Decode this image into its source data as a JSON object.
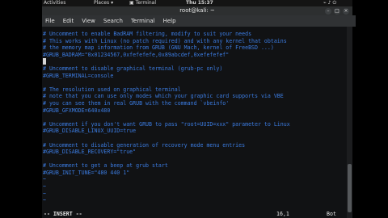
{
  "topbar": {
    "activities": "Activities",
    "places": "Places",
    "terminal_app": "Terminal",
    "clock": "Thu 15:37"
  },
  "window": {
    "title": "root@kali: ~"
  },
  "menu": [
    "File",
    "Edit",
    "View",
    "Search",
    "Terminal",
    "Help"
  ],
  "editor": {
    "lines": [
      {
        "text": "# Uncomment to enable BadRAM filtering, modify to suit your needs",
        "style": "comment"
      },
      {
        "text": "# This works with Linux (no patch required) and with any kernel that obtains",
        "style": "comment"
      },
      {
        "text": "# the memory map information from GRUB (GNU Mach, kernel of FreeBSD ...)",
        "style": "comment"
      },
      {
        "text": "#GRUB_BADRAM=\"0x01234567,0xfefefefe,0x89abcdef,0xefefefef\"",
        "style": "comment"
      },
      {
        "text": "",
        "style": "cursor"
      },
      {
        "text": "# Uncomment to disable graphical terminal (grub-pc only)",
        "style": "comment"
      },
      {
        "text": "#GRUB_TERMINAL=console",
        "style": "comment"
      },
      {
        "text": "",
        "style": "normal"
      },
      {
        "text": "# The resolution used on graphical terminal",
        "style": "comment"
      },
      {
        "text": "# note that you can use only modes which your graphic card supports via VBE",
        "style": "comment"
      },
      {
        "text": "# you can see them in real GRUB with the command `vbeinfo'",
        "style": "comment"
      },
      {
        "text": "#GRUB_GFXMODE=640x480",
        "style": "comment"
      },
      {
        "text": "",
        "style": "normal"
      },
      {
        "text": "# Uncomment if you don't want GRUB to pass \"root=UUID=xxx\" parameter to Linux",
        "style": "comment"
      },
      {
        "text": "#GRUB_DISABLE_LINUX_UUID=true",
        "style": "comment"
      },
      {
        "text": "",
        "style": "normal"
      },
      {
        "text": "# Uncomment to disable generation of recovery mode menu entries",
        "style": "comment"
      },
      {
        "text": "#GRUB_DISABLE_RECOVERY=\"true\"",
        "style": "comment"
      },
      {
        "text": "",
        "style": "normal"
      },
      {
        "text": "# Uncomment to get a beep at grub start",
        "style": "comment"
      },
      {
        "text": "#GRUB_INIT_TUNE=\"480 440 1\"",
        "style": "comment"
      },
      {
        "text": "~",
        "style": "tilde"
      },
      {
        "text": "~",
        "style": "tilde"
      },
      {
        "text": "~",
        "style": "tilde"
      },
      {
        "text": "~",
        "style": "tilde"
      }
    ],
    "mode": "-- INSERT --",
    "position": "16,1",
    "scroll": "Bot"
  },
  "colors": {
    "comment": "#3b7be0",
    "background": "#111214"
  }
}
